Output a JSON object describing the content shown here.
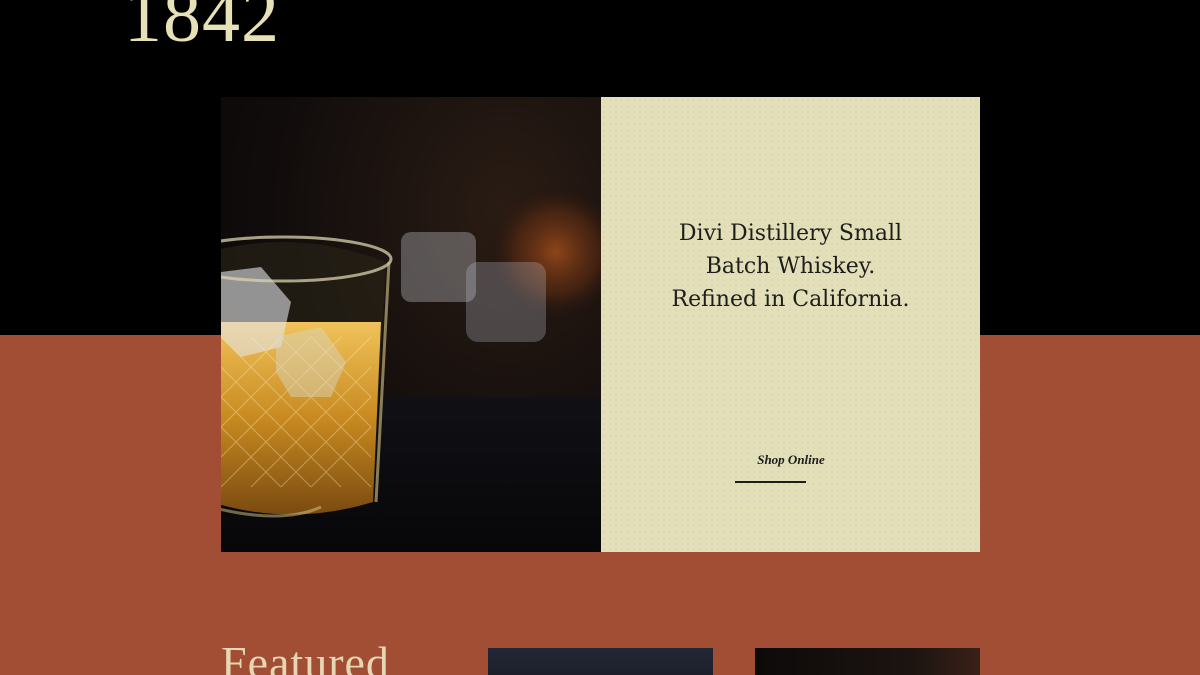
{
  "header": {
    "year": "1842"
  },
  "hero": {
    "image_alt": "Glass of whiskey with ice",
    "lines": [
      "Divi Distillery Small",
      "Batch Whiskey.",
      "Refined in California."
    ],
    "cta_label": "Shop Online"
  },
  "featured": {
    "heading": "Featured"
  },
  "colors": {
    "top_band": "#000000",
    "bottom_band": "#a24e34",
    "card": "#e3dfb9",
    "accent_text": "#e6e1b6"
  }
}
